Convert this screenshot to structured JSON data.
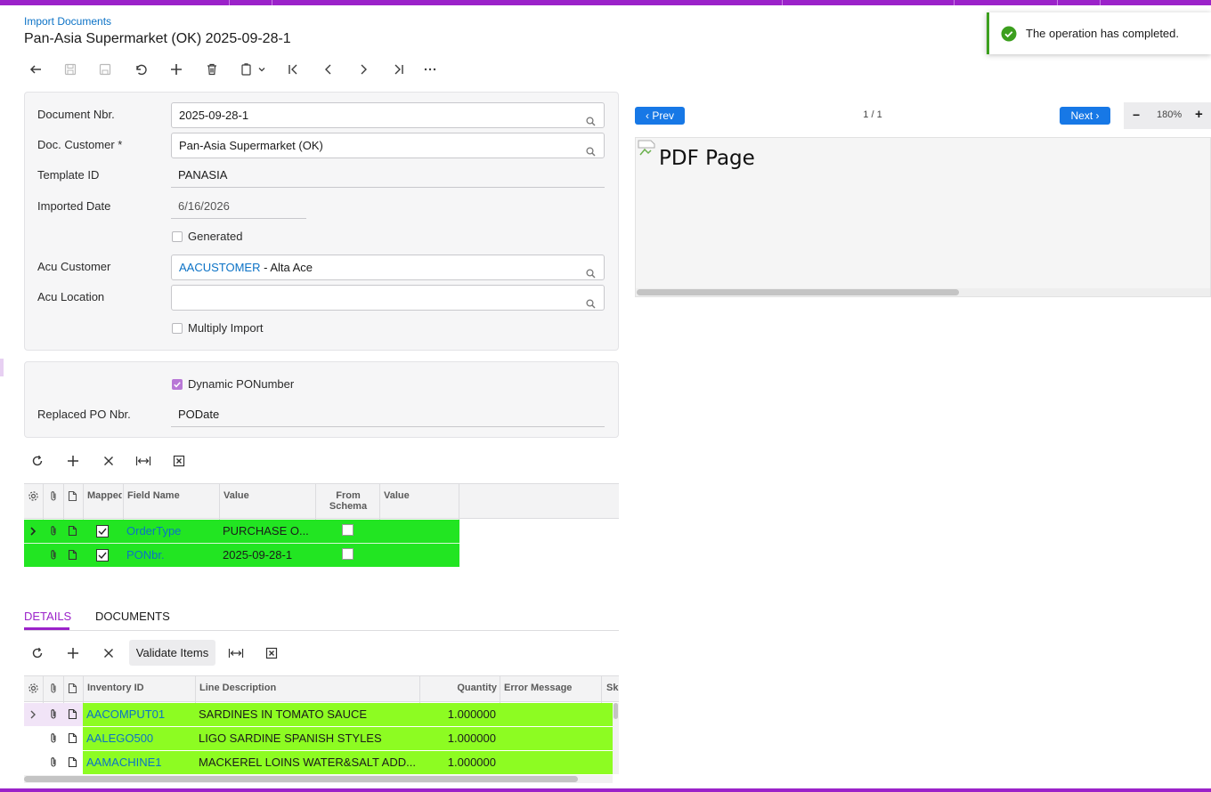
{
  "header": {
    "breadcrumb": "Import Documents",
    "title": "Pan-Asia Supermarket (OK) 2025-09-28-1"
  },
  "toolbar": {
    "icons": [
      "back-icon",
      "save-icon",
      "save-close-icon",
      "undo-icon",
      "add-icon",
      "delete-icon",
      "copy-paste-icon",
      "first-icon",
      "prev-icon",
      "next-icon",
      "last-icon",
      "more-icon"
    ]
  },
  "toast": {
    "message": "The operation has completed."
  },
  "form": {
    "document_nbr_label": "Document Nbr.",
    "document_nbr": "2025-09-28-1",
    "doc_customer_label": "Doc. Customer *",
    "doc_customer": "Pan-Asia Supermarket (OK)",
    "template_id_label": "Template ID",
    "template_id": "PANASIA",
    "imported_date_label": "Imported Date",
    "imported_date": "6/16/2026",
    "generated_label": "Generated",
    "acu_customer_label": "Acu Customer",
    "acu_customer_id": "AACUSTOMER",
    "acu_customer_name": " - Alta Ace",
    "acu_location_label": "Acu Location",
    "acu_location": "",
    "multiply_import_label": "Multiply Import"
  },
  "po_section": {
    "dynamic_label": "Dynamic PONumber",
    "dynamic_checked": true,
    "replaced_label": "Replaced PO Nbr.",
    "replaced_value": "PODate"
  },
  "mapping_grid": {
    "headers": {
      "mapped": "Mapped",
      "field_name": "Field Name",
      "value": "Value",
      "from_schema": "From Schema",
      "value2": "Value"
    },
    "rows": [
      {
        "field": "OrderType",
        "value": "PURCHASE O...",
        "mapped": true,
        "from_schema": false
      },
      {
        "field": "PONbr.",
        "value": "2025-09-28-1",
        "mapped": true,
        "from_schema": false
      }
    ]
  },
  "tabs": {
    "details": "DETAILS",
    "documents": "DOCUMENTS"
  },
  "details_toolbar": {
    "validate": "Validate Items"
  },
  "details_grid": {
    "headers": {
      "inventory_id": "Inventory ID",
      "line_description": "Line Description",
      "quantity": "Quantity",
      "error_message": "Error Message",
      "sku": "Sk"
    },
    "rows": [
      {
        "inventory_id": "AACOMPUT01",
        "description": "SARDINES IN TOMATO SAUCE",
        "quantity": "1.000000"
      },
      {
        "inventory_id": "AALEGO500",
        "description": "LIGO SARDINE SPANISH STYLES",
        "quantity": "1.000000"
      },
      {
        "inventory_id": "AAMACHINE1",
        "description": "MACKEREL LOINS WATER&SALT ADD...",
        "quantity": "1.000000"
      }
    ]
  },
  "pdf_viewer": {
    "prev": "‹ Prev",
    "page_indicator": "1 / 1",
    "next": "Next ›",
    "zoom": "180%",
    "zoom_out": "−",
    "zoom_in": "+",
    "image_alt": "PDF Page"
  },
  "colors": {
    "accent": "#9b22c9",
    "link": "#0b72c6",
    "green_row": "#22e522",
    "lime_row": "#8dfc22",
    "success": "#3c9f1e"
  }
}
